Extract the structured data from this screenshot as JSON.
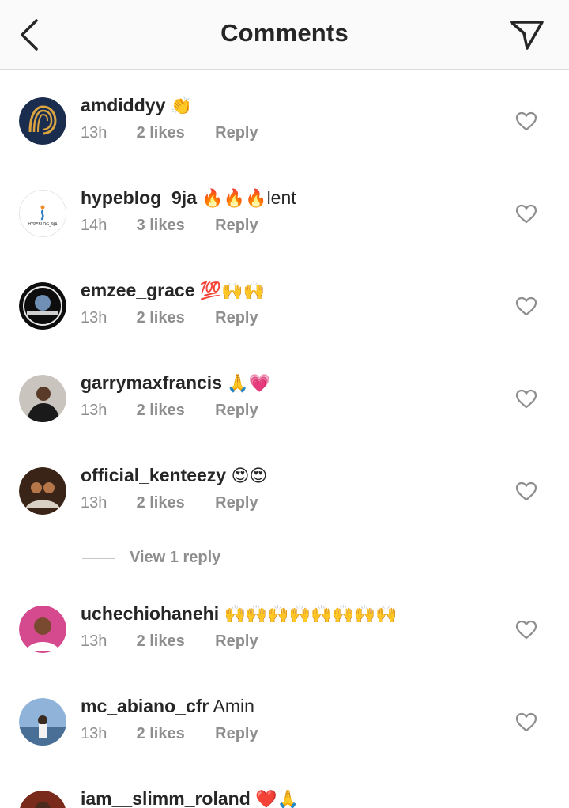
{
  "header": {
    "title": "Comments",
    "back_icon": "chevron-left-icon",
    "send_icon": "paper-plane-icon"
  },
  "comments": [
    {
      "username": "amdiddyy",
      "text": "",
      "emoji": "👏",
      "time": "13h",
      "likes": "2 likes",
      "reply": "Reply"
    },
    {
      "username": "hypeblog_9ja",
      "text": "lent",
      "emoji": "🔥🔥🔥",
      "time": "14h",
      "likes": "3 likes",
      "reply": "Reply"
    },
    {
      "username": "emzee_grace",
      "text": "",
      "emoji": "💯🙌🙌",
      "time": "13h",
      "likes": "2 likes",
      "reply": "Reply"
    },
    {
      "username": "garrymaxfrancis",
      "text": "",
      "emoji": "🙏💗",
      "time": "13h",
      "likes": "2 likes",
      "reply": "Reply"
    },
    {
      "username": "official_kenteezy",
      "text": "",
      "emoji": "😍😍",
      "time": "13h",
      "likes": "2 likes",
      "reply": "Reply"
    },
    {
      "username": "uchechiohanehi",
      "text": "",
      "emoji": "🙌🙌🙌🙌🙌🙌🙌🙌",
      "time": "13h",
      "likes": "2 likes",
      "reply": "Reply"
    },
    {
      "username": "mc_abiano_cfr",
      "text": "Amin",
      "emoji": "",
      "time": "13h",
      "likes": "2 likes",
      "reply": "Reply"
    },
    {
      "username": "iam__slimm_roland",
      "text": "",
      "emoji": "❤️🙏",
      "time": "",
      "likes": "",
      "reply": ""
    }
  ],
  "view_replies": {
    "label": "View 1 reply"
  },
  "avatar_logo_text": "HYPEBLOG_9JA",
  "colors": {
    "accent": "#262626",
    "meta": "#8e8e8e",
    "header_bg": "#fafafa"
  }
}
